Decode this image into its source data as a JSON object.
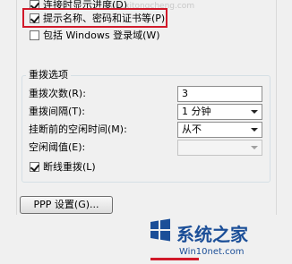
{
  "options": {
    "show_progress": {
      "label": "连接时显示进度(D)",
      "checked": true
    },
    "prompt_credentials": {
      "label": "提示名称、密码和证书等(P)",
      "checked": true
    },
    "include_domain": {
      "label": "包括 Windows 登录域(W)",
      "checked": false
    }
  },
  "redial": {
    "title": "重拨选项",
    "attempts_label": "重拨次数(R):",
    "attempts_value": "3",
    "interval_label": "重拨间隔(T):",
    "interval_value": "1 分钟",
    "idle_label": "挂断前的空闲时间(M):",
    "idle_value": "从不",
    "idle_threshold_label": "空闲阈值(E):",
    "idle_threshold_value": "",
    "redial_if_dropped": {
      "label": "断线重拨(L)",
      "checked": true
    }
  },
  "ppp_button": "PPP 设置(G)...",
  "watermark": {
    "faint": "www.xitongcheng.com",
    "title": "系统之家",
    "url": "Win10net.com"
  },
  "colors": {
    "highlight": "#d11a2a",
    "brand": "#1c4f98"
  }
}
